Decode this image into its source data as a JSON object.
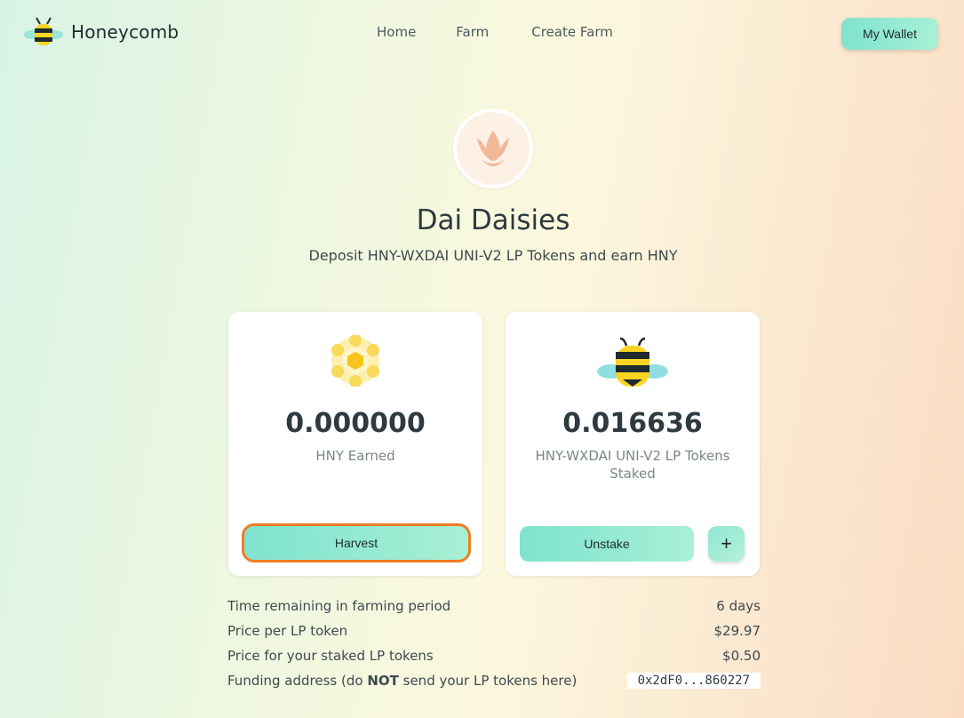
{
  "app": {
    "name": "Honeycomb"
  },
  "nav": {
    "items": [
      "Home",
      "Farm",
      "Create Farm"
    ]
  },
  "wallet_button": "My Wallet",
  "farm": {
    "title": "Dai Daisies",
    "subtitle": "Deposit HNY-WXDAI UNI-V2 LP Tokens and earn HNY"
  },
  "cards": {
    "earned": {
      "value": "0.000000",
      "label": "HNY Earned",
      "button": "Harvest",
      "icon": "honeycomb-coin-icon"
    },
    "staked": {
      "value": "0.016636",
      "label": "HNY-WXDAI UNI-V2 LP Tokens Staked",
      "button": "Unstake",
      "plus": "+",
      "icon": "bee-icon"
    }
  },
  "stats": {
    "rows": [
      {
        "label": "Time remaining in farming period",
        "value": "6 days"
      },
      {
        "label": "Price per LP token",
        "value": "$29.97"
      },
      {
        "label": "Price for your staked LP tokens",
        "value": "$0.50"
      }
    ],
    "funding": {
      "label_pre": "Funding address (do ",
      "label_bold": "NOT",
      "label_post": " send your LP tokens here)",
      "address": "0x2dF0...860227"
    }
  },
  "colors": {
    "accent_start": "#7fe3cf",
    "accent_end": "#a8f0d4",
    "highlight": "#f07c22",
    "badge_bg": "#fdf1e6",
    "flower": "#f3b79a"
  }
}
